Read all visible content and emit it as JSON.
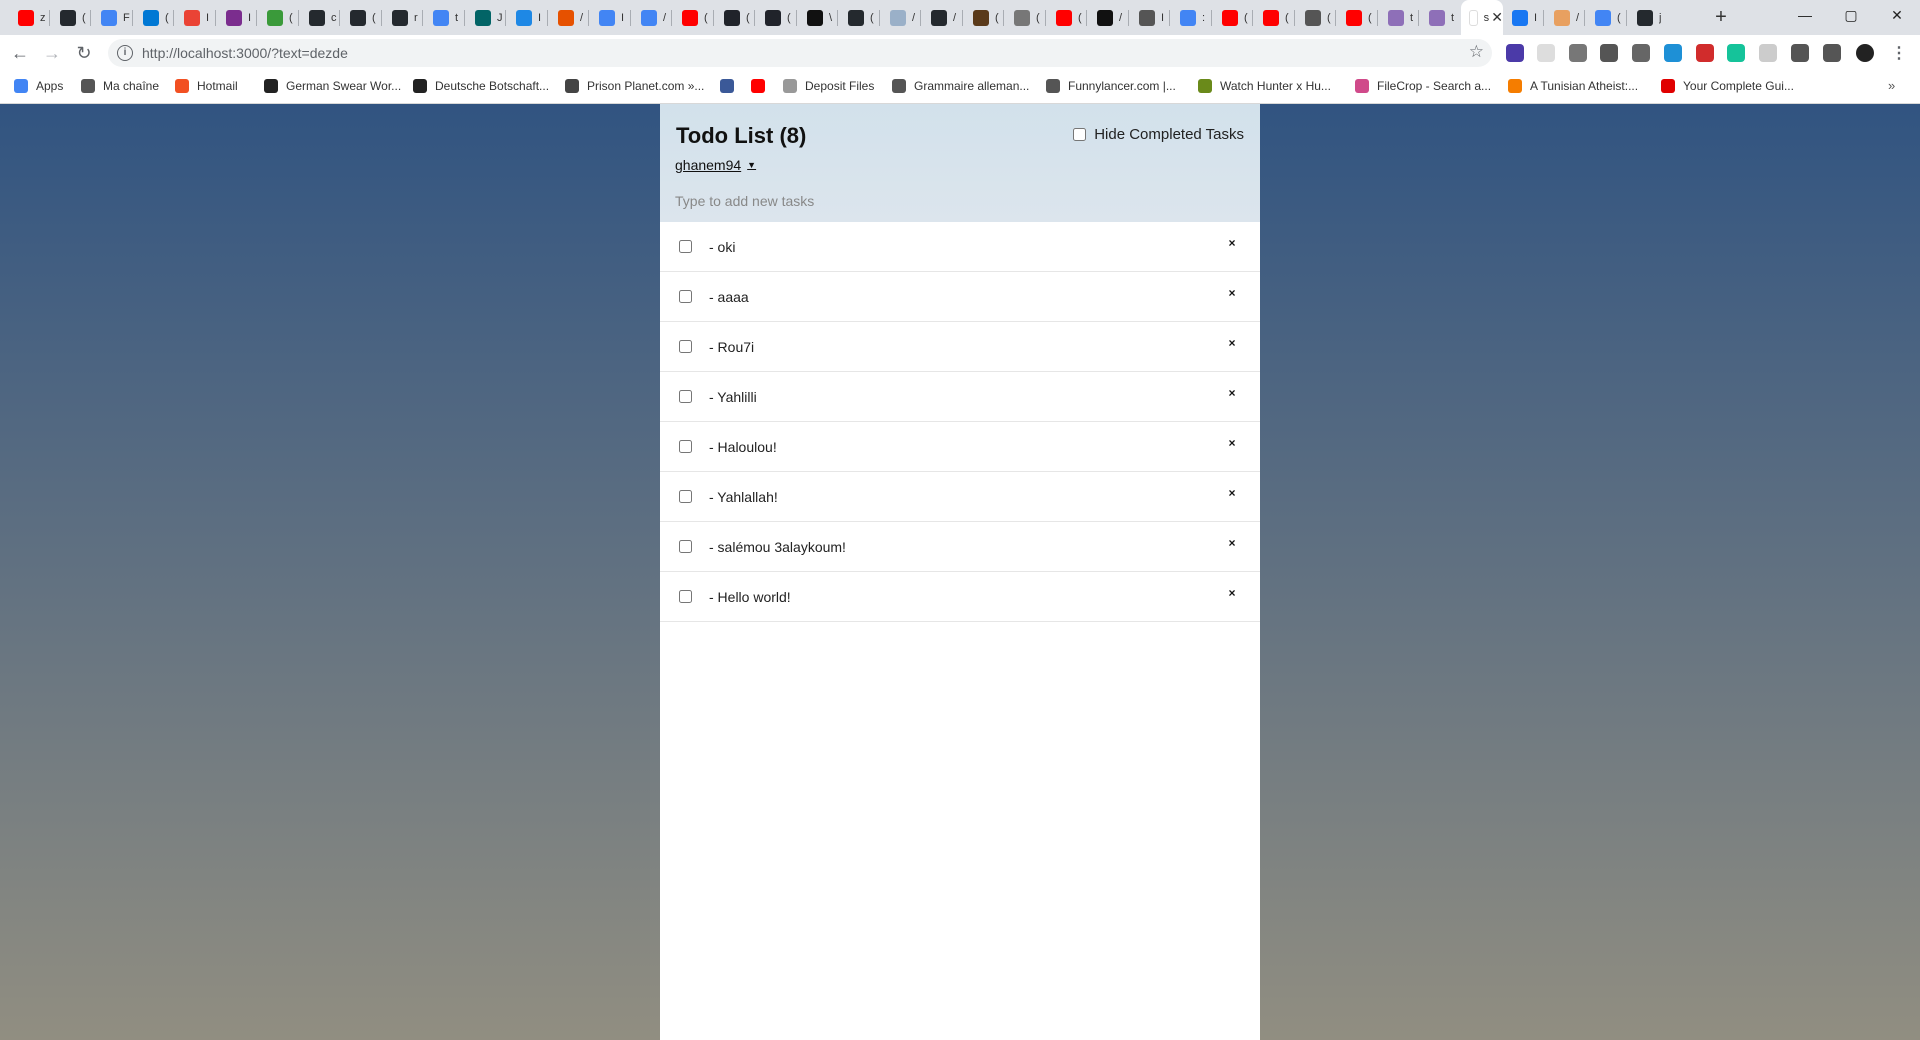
{
  "browser": {
    "tabs": [
      {
        "letter": "z",
        "icon": "youtube-icon",
        "color": "#ff0000"
      },
      {
        "letter": "(",
        "icon": "github-icon",
        "color": "#24292e"
      },
      {
        "letter": "F",
        "icon": "google-icon",
        "color": "#4285f4"
      },
      {
        "letter": "(",
        "icon": "outlook-icon",
        "color": "#0078d4"
      },
      {
        "letter": "I",
        "icon": "gmail-icon",
        "color": "#ea4335"
      },
      {
        "letter": "I",
        "icon": "app-icon",
        "color": "#7b2d8e"
      },
      {
        "letter": "(",
        "icon": "leaf-icon",
        "color": "#3a9a3a"
      },
      {
        "letter": "c",
        "icon": "github-icon",
        "color": "#24292e"
      },
      {
        "letter": "(",
        "icon": "github-icon",
        "color": "#24292e"
      },
      {
        "letter": "r",
        "icon": "github-icon",
        "color": "#24292e"
      },
      {
        "letter": "t",
        "icon": "google-icon",
        "color": "#4285f4"
      },
      {
        "letter": "J",
        "icon": "xing-icon",
        "color": "#026466"
      },
      {
        "letter": "I",
        "icon": "sl-icon",
        "color": "#1e88e5"
      },
      {
        "letter": "/",
        "icon": "fire-icon",
        "color": "#e65100"
      },
      {
        "letter": "I",
        "icon": "google-icon",
        "color": "#4285f4"
      },
      {
        "letter": "/",
        "icon": "google-icon",
        "color": "#4285f4"
      },
      {
        "letter": "(",
        "icon": "youtube-icon",
        "color": "#ff0000"
      },
      {
        "letter": "(",
        "icon": "react-icon",
        "color": "#20232a"
      },
      {
        "letter": "(",
        "icon": "react-icon",
        "color": "#20232a"
      },
      {
        "letter": "\\",
        "icon": "dark-app-icon",
        "color": "#111111"
      },
      {
        "letter": "(",
        "icon": "github-icon",
        "color": "#24292e"
      },
      {
        "letter": "/",
        "icon": "window-icon",
        "color": "#9ab0c8"
      },
      {
        "letter": "/",
        "icon": "github-icon",
        "color": "#24292e"
      },
      {
        "letter": "(",
        "icon": "cc-icon",
        "color": "#5a3a1a"
      },
      {
        "letter": "(",
        "icon": "t-icon",
        "color": "#777777"
      },
      {
        "letter": "(",
        "icon": "youtube-icon",
        "color": "#ff0000"
      },
      {
        "letter": "/",
        "icon": "a-icon",
        "color": "#111111"
      },
      {
        "letter": "I",
        "icon": "globe-icon",
        "color": "#555555"
      },
      {
        "letter": ":",
        "icon": "google-icon",
        "color": "#4285f4"
      },
      {
        "letter": "(",
        "icon": "youtube-icon",
        "color": "#ff0000"
      },
      {
        "letter": "(",
        "icon": "youtube-icon",
        "color": "#ff0000"
      },
      {
        "letter": "(",
        "icon": "audio-icon",
        "color": "#555555"
      },
      {
        "letter": "(",
        "icon": "youtube-icon",
        "color": "#ff0000"
      },
      {
        "letter": "t",
        "icon": "h-icon",
        "color": "#8e6fb8"
      },
      {
        "letter": "t",
        "icon": "h-icon",
        "color": "#8e6fb8"
      },
      {
        "letter": "s",
        "icon": "active-tab-icon",
        "color": "#ffffff",
        "active": true
      },
      {
        "letter": "I",
        "icon": "facebook-icon",
        "color": "#1877f2"
      },
      {
        "letter": "/",
        "icon": "hand-icon",
        "color": "#e8a060"
      },
      {
        "letter": "(",
        "icon": "google-icon",
        "color": "#4285f4"
      },
      {
        "letter": "j",
        "icon": "github-icon",
        "color": "#24292e"
      }
    ],
    "url": "http://localhost:3000/?text=dezde",
    "bookmarks": [
      {
        "label": "Apps",
        "icon": "apps-grid-icon",
        "color": "#4285f4"
      },
      {
        "label": "Ma chaîne",
        "icon": "globe-icon",
        "color": "#555555"
      },
      {
        "label": "Hotmail",
        "icon": "windows-icon",
        "color": "#f25022"
      },
      {
        "label": "German Swear Wor...",
        "icon": "exclamation-icon",
        "color": "#222222"
      },
      {
        "label": "Deutsche Botschaft...",
        "icon": "flag-icon",
        "color": "#222222"
      },
      {
        "label": "Prison Planet.com »...",
        "icon": "planet-icon",
        "color": "#444444"
      },
      {
        "label": "",
        "icon": "facebook-icon",
        "color": "#3b5998"
      },
      {
        "label": "",
        "icon": "youtube-icon",
        "color": "#ff0000"
      },
      {
        "label": "Deposit Files",
        "icon": "deposit-icon",
        "color": "#999999"
      },
      {
        "label": "Grammaire alleman...",
        "icon": "globe-icon",
        "color": "#555555"
      },
      {
        "label": "Funnylancer.com |...",
        "icon": "globe-icon",
        "color": "#555555"
      },
      {
        "label": "Watch Hunter x Hu...",
        "icon": "hunter-icon",
        "color": "#6a8a1a"
      },
      {
        "label": "FileCrop - Search a...",
        "icon": "filecrop-icon",
        "color": "#d04a8a"
      },
      {
        "label": "A Tunisian Atheist:...",
        "icon": "blogger-icon",
        "color": "#f57d00"
      },
      {
        "label": "Your Complete Gui...",
        "icon": "rh-icon",
        "color": "#e00000"
      }
    ]
  },
  "app": {
    "title": "Todo List (8)",
    "hide_completed_label": "Hide Completed Tasks",
    "username": "ghanem94",
    "new_task_placeholder": "Type to add new tasks",
    "delete_glyph": "×",
    "tasks": [
      {
        "text": "- oki",
        "checked": false
      },
      {
        "text": "- aaaa",
        "checked": false
      },
      {
        "text": "- Rou7i",
        "checked": false
      },
      {
        "text": "- Yahlilli",
        "checked": false
      },
      {
        "text": "- Haloulou!",
        "checked": false
      },
      {
        "text": "- Yahlallah!",
        "checked": false
      },
      {
        "text": "- salémou 3alaykoum!",
        "checked": false
      },
      {
        "text": "- Hello world!",
        "checked": false
      }
    ]
  },
  "colors": {
    "background_top": "#315481",
    "background_bottom": "#918e81",
    "header_bg": "#d4e2ec"
  }
}
